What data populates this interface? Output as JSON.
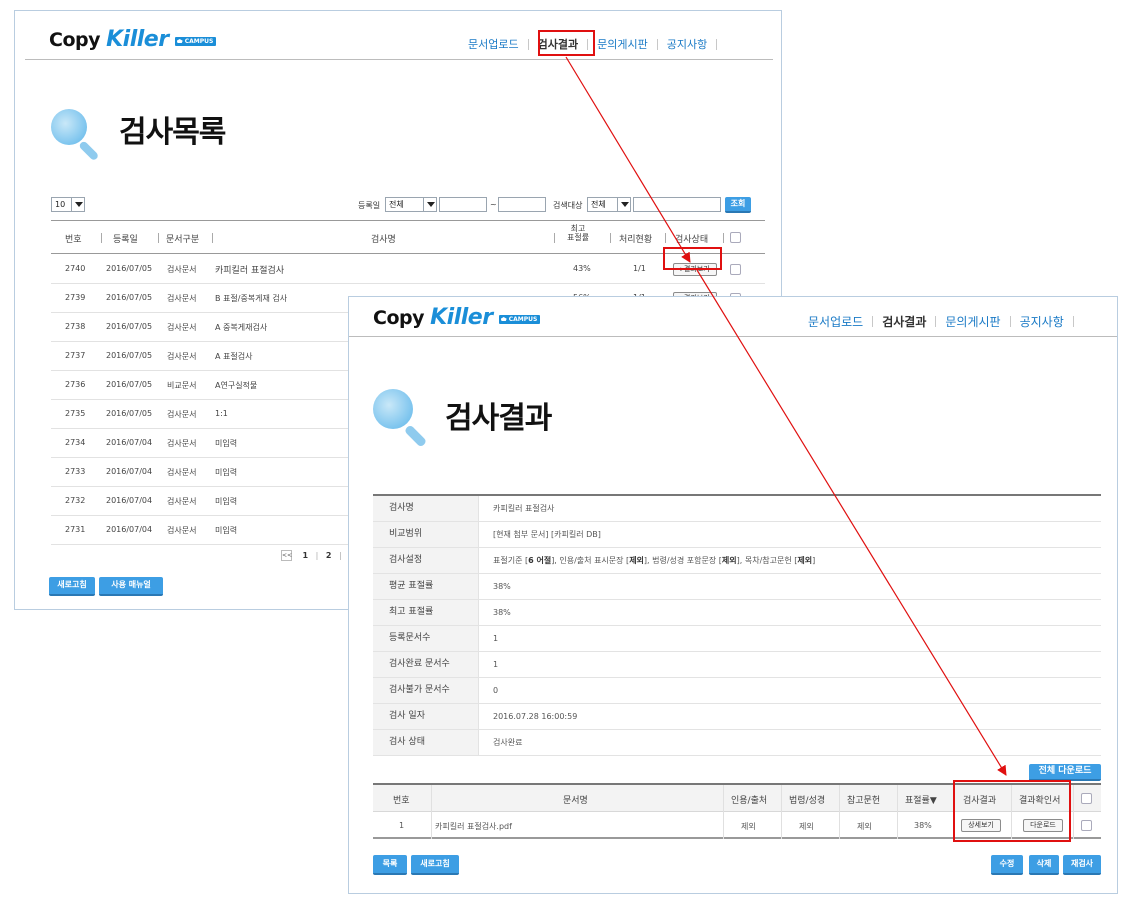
{
  "brand": {
    "copy": "Copy",
    "killer": "Killer",
    "campus": "CAMPUS"
  },
  "nav": [
    "문서업로드",
    "검사결과",
    "문의게시판",
    "공지사항"
  ],
  "list_page": {
    "title": "검사목록",
    "page_size": "10",
    "filters": {
      "reg_label": "등록일",
      "reg_value": "전체",
      "tilde": "~",
      "target_label": "검색대상",
      "target_value": "전체",
      "search_button": "조회"
    },
    "columns": [
      "번호",
      "등록일",
      "문서구분",
      "검사명",
      "최고\n표절률",
      "처리현황",
      "검사상태"
    ],
    "rows": [
      {
        "no": "2740",
        "date": "2016/07/05",
        "type": "검사문서",
        "name": "카피킬러 표절검사",
        "rate": "43%",
        "progress": "1/1",
        "status": "▸결과보기"
      },
      {
        "no": "2739",
        "date": "2016/07/05",
        "type": "검사문서",
        "name": "B 표절/중복게재 검사",
        "rate": "56%",
        "progress": "1/1",
        "status": "▸결과보기"
      },
      {
        "no": "2738",
        "date": "2016/07/05",
        "type": "검사문서",
        "name": "A 중복게재검사"
      },
      {
        "no": "2737",
        "date": "2016/07/05",
        "type": "검사문서",
        "name": "A 표절검사"
      },
      {
        "no": "2736",
        "date": "2016/07/05",
        "type": "비교문서",
        "name": "A연구실적물"
      },
      {
        "no": "2735",
        "date": "2016/07/05",
        "type": "검사문서",
        "name": "1:1"
      },
      {
        "no": "2734",
        "date": "2016/07/04",
        "type": "검사문서",
        "name": "미입력"
      },
      {
        "no": "2733",
        "date": "2016/07/04",
        "type": "검사문서",
        "name": "미입력"
      },
      {
        "no": "2732",
        "date": "2016/07/04",
        "type": "검사문서",
        "name": "미입력"
      },
      {
        "no": "2731",
        "date": "2016/07/04",
        "type": "검사문서",
        "name": "미입력"
      }
    ],
    "pager": {
      "first": "<<",
      "p1": "1",
      "p2": "2",
      "p3": "3"
    },
    "buttons": {
      "refresh": "새로고침",
      "manual": "사용 매뉴얼"
    }
  },
  "result_page": {
    "title": "검사결과",
    "info": [
      {
        "label": "검사명",
        "value": "카피킬러 표절검사"
      },
      {
        "label": "비교범위",
        "value": "[현재 첨부 문서] [카피킬러 DB]"
      },
      {
        "label": "검사설정",
        "value": ""
      },
      {
        "label": "평균 표절률",
        "value": "38%"
      },
      {
        "label": "최고 표절률",
        "value": "38%"
      },
      {
        "label": "등록문서수",
        "value": "1"
      },
      {
        "label": "검사완료 문서수",
        "value": "1"
      },
      {
        "label": "검사불가 문서수",
        "value": "0"
      },
      {
        "label": "검사 일자",
        "value": "2016.07.28 16:00:59"
      },
      {
        "label": "검사 상태",
        "value": "검사완료"
      }
    ],
    "setting": {
      "a": "표절기준 [",
      "b": "6 어절",
      "c": "], 인용/출처 표시문장 [",
      "d": "제외",
      "e": "], 법령/성경 포함문장 [",
      "f": "제외",
      "g": "], 목차/참고문헌 [",
      "h": "제외",
      "i": "]"
    },
    "download_all": "전체 다운로드",
    "columns": [
      "번호",
      "문서명",
      "인용/출처",
      "법령/성경",
      "참고문헌",
      "표절률▼",
      "검사결과",
      "결과확인서"
    ],
    "row": {
      "no": "1",
      "name": "카피킬러 표절검사.pdf",
      "cite": "제외",
      "law": "제외",
      "ref": "제외",
      "rate": "38%",
      "detail": "상세보기",
      "download": "다운로드"
    },
    "buttons": {
      "list": "목록",
      "refresh": "새로고침",
      "edit": "수정",
      "delete": "삭제",
      "recheck": "재검사"
    }
  },
  "colors": {
    "accent": "#1a8ed8",
    "button": "#3d9ee4",
    "highlight": "#e01010"
  }
}
